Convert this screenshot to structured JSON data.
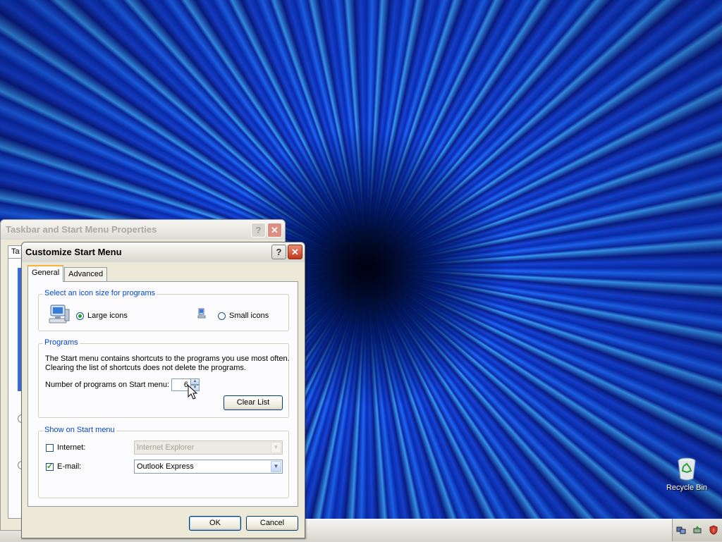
{
  "desktop": {
    "recycle_bin_label": "Recycle Bin"
  },
  "back_window": {
    "title": "Taskbar and Start Menu Properties",
    "tab_label": "Ta",
    "help_glyph": "?",
    "close_glyph": "✕"
  },
  "dialog": {
    "title": "Customize Start Menu",
    "help_glyph": "?",
    "close_glyph": "✕",
    "tabs": [
      {
        "label": "General",
        "active": true
      },
      {
        "label": "Advanced",
        "active": false
      }
    ],
    "icon_size_group": {
      "title": "Select an icon size for programs",
      "large_label": "Large icons",
      "small_label": "Small icons",
      "selected": "large"
    },
    "programs_group": {
      "title": "Programs",
      "description_line1": "The Start menu contains shortcuts to the programs you use most often.",
      "description_line2": "Clearing the list of shortcuts does not delete the programs.",
      "count_label": "Number of programs on Start menu:",
      "count_value": "6",
      "clear_button": "Clear List"
    },
    "show_group": {
      "title": "Show on Start menu",
      "internet_label": "Internet:",
      "internet_checked": false,
      "internet_value": "Internet Explorer",
      "email_label": "E-mail:",
      "email_checked": true,
      "email_value": "Outlook Express"
    },
    "ok_button": "OK",
    "cancel_button": "Cancel"
  },
  "colors": {
    "accent": "#0046d5",
    "check_green": "#21a121",
    "tab_highlight": "#f6b33e"
  }
}
